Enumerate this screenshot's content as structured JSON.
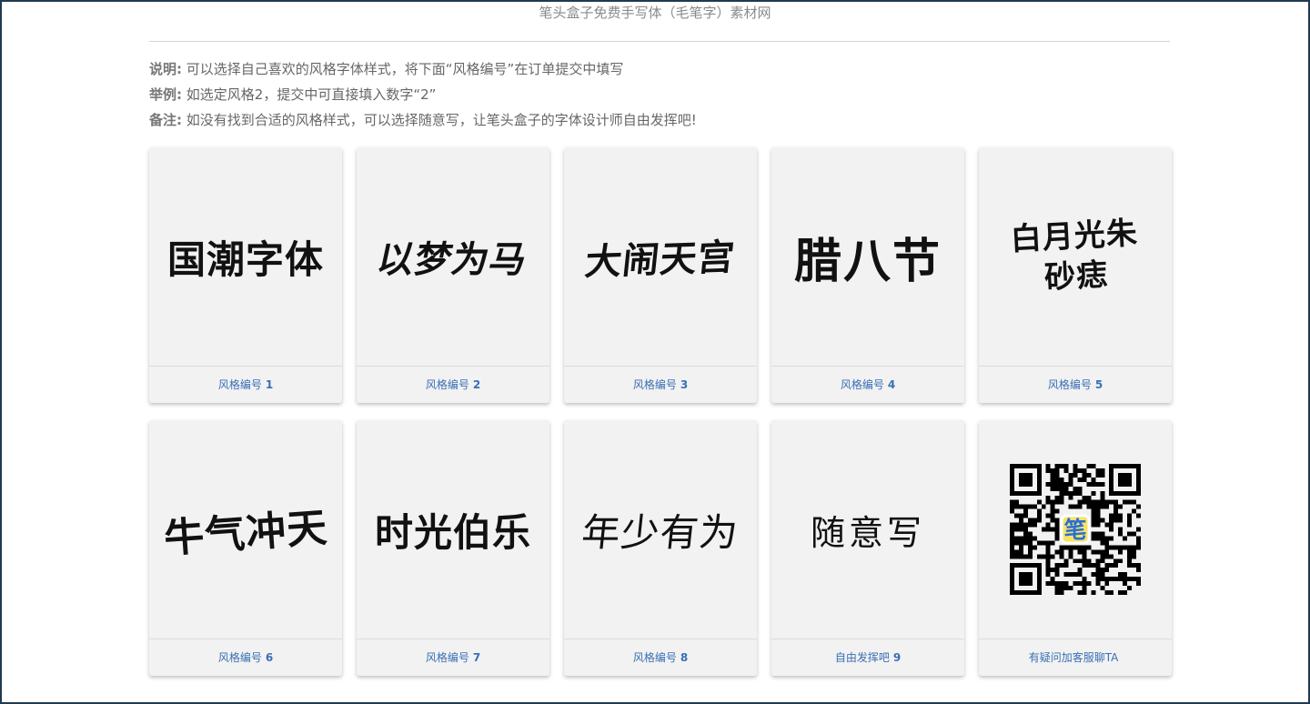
{
  "header": {
    "site_title": "笔头盒子免费手写体（毛笔字）素材网"
  },
  "notes": [
    {
      "label": "说明:",
      "text": "可以选择自己喜欢的风格字体样式，将下面“风格编号”在订单提交中填写"
    },
    {
      "label": "举例:",
      "text": "如选定风格2，提交中可直接填入数字“2”"
    },
    {
      "label": "备注:",
      "text": "如没有找到合适的风格样式，可以选择随意写，让笔头盒子的字体设计师自由发挥吧!"
    }
  ],
  "cards": [
    {
      "art": "国潮字体",
      "label": "风格编号",
      "num": "1"
    },
    {
      "art": "以梦为马",
      "label": "风格编号",
      "num": "2"
    },
    {
      "art": "大闹天宫",
      "label": "风格编号",
      "num": "3"
    },
    {
      "art": "腊八节",
      "label": "风格编号",
      "num": "4"
    },
    {
      "art": "白月光朱砂痣",
      "label": "风格编号",
      "num": "5"
    },
    {
      "art": "牛气冲天",
      "label": "风格编号",
      "num": "6"
    },
    {
      "art": "时光伯乐",
      "label": "风格编号",
      "num": "7"
    },
    {
      "art": "年少有为",
      "label": "风格编号",
      "num": "8"
    },
    {
      "art": "随意写",
      "label": "自由发挥吧",
      "num": "9"
    },
    {
      "art": "",
      "qr_center": "笔",
      "label": "有疑问加客服聊TA",
      "num": ""
    }
  ],
  "colors": {
    "link": "#3a6fb5",
    "card_bg": "#f2f2f2",
    "frame_border": "#1f3b50"
  }
}
